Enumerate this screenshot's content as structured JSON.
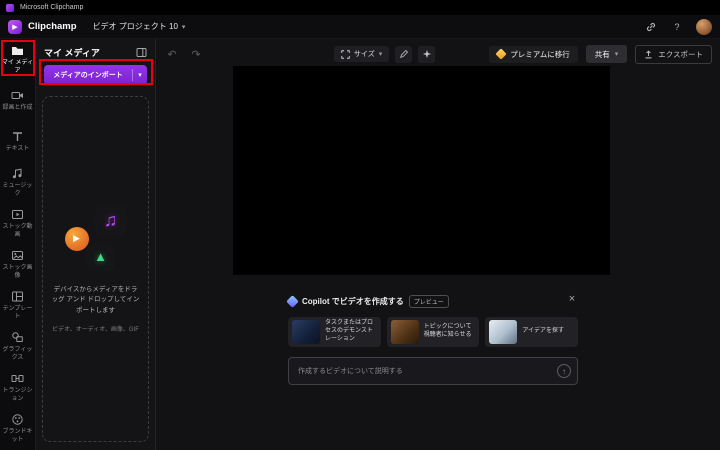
{
  "colors": {
    "accent_purple": "#8b2be2",
    "annotation_red": "#e60012",
    "premium_gold": "#f0b429"
  },
  "titlebar": {
    "app_title": "Microsoft Clipchamp"
  },
  "header": {
    "brand": "Clipchamp",
    "project_title": "ビデオ プロジェクト 10"
  },
  "sidebar": {
    "items": [
      {
        "label": "マイ メディア",
        "icon": "folder-icon"
      },
      {
        "label": "録画と作成",
        "icon": "camera-icon"
      },
      {
        "label": "テキスト",
        "icon": "text-icon"
      },
      {
        "label": "ミュージック",
        "icon": "music-icon"
      },
      {
        "label": "ストック動画",
        "icon": "stock-video-icon"
      },
      {
        "label": "ストック画像",
        "icon": "stock-image-icon"
      },
      {
        "label": "テンプレート",
        "icon": "template-icon"
      },
      {
        "label": "グラフィックス",
        "icon": "graphics-icon"
      },
      {
        "label": "トランジション",
        "icon": "transitions-icon"
      },
      {
        "label": "ブランドキット",
        "icon": "brand-kit-icon"
      }
    ]
  },
  "media_panel": {
    "title": "マイ メディア",
    "import_button_label": "メディアのインポート",
    "dropzone_text": "デバイスからメディアをドラッグ アンド ドロップしてインポートします",
    "dropzone_formats": "ビデオ、オーディオ、画像、GIF"
  },
  "toolbar": {
    "size_label": "サイズ",
    "premium_label": "プレミアムに移行",
    "share_label": "共有",
    "export_label": "エクスポート"
  },
  "copilot": {
    "title": "Copilot でビデオを作成する",
    "badge": "プレビュー",
    "cards": [
      {
        "label": "タスクまたはプロセスのデモンストレーション"
      },
      {
        "label": "トピックについて視聴者に知らせる"
      },
      {
        "label": "アイデアを探す"
      }
    ],
    "input_placeholder": "作成するビデオについて説明する"
  },
  "glyphs": {
    "chevron_down": "▾",
    "undo": "↶",
    "redo": "↷",
    "close": "×",
    "music_note": "♫",
    "play": "▶",
    "triangle": "▲",
    "arrow_up": "↑",
    "help": "?"
  }
}
